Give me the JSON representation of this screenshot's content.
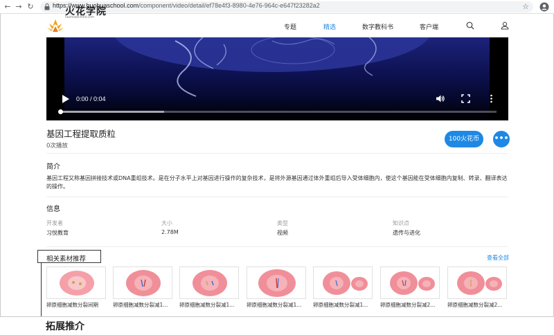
{
  "browser": {
    "url_host": "https://www.huohuaschool.com",
    "url_path": "/component/video/detail/ef78e4f3-8980-4e76-964c-e647f23282a2"
  },
  "header": {
    "logo_text": "火花学院",
    "logo_sub": "huohuaschool.com",
    "nav": [
      "专题",
      "精选",
      "数字教科书",
      "客户端"
    ],
    "active_nav": "精选",
    "accent_color": "#1e88e5"
  },
  "video": {
    "time": "0:00 / 0:04"
  },
  "resource": {
    "title": "基因工程提取质粒",
    "plays": "0次播放",
    "price_label": "100火花币",
    "more_label": "•••"
  },
  "intro": {
    "heading": "简介",
    "text": "基因工程又称基因拼接技术或DNA重组技术。是在分子水平上对基因进行操作的复杂技术，是将外源基因通过体外重组后导入受体细胞内，使这个基因能在受体细胞内复制、转录、翻译表达的操作。"
  },
  "info": {
    "heading": "信息",
    "fields": [
      {
        "label": "开发者",
        "value": "习悦教育"
      },
      {
        "label": "大小",
        "value": "2.78M"
      },
      {
        "label": "类型",
        "value": "视频"
      },
      {
        "label": "知识点",
        "value": "遗传与进化"
      }
    ]
  },
  "related": {
    "heading": "相关素材推荐",
    "view_all": "查看全部",
    "items": [
      {
        "caption": "卵原细胞减数分裂间期"
      },
      {
        "caption": "卵原细胞减数分裂减1..."
      },
      {
        "caption": "卵原细胞减数分裂减1..."
      },
      {
        "caption": "卵原细胞减数分裂减1..."
      },
      {
        "caption": "卵原细胞减数分裂减1..."
      },
      {
        "caption": "卵原细胞减数分裂减2..."
      },
      {
        "caption": "卵原细胞减数分裂减2..."
      }
    ]
  },
  "annotation": {
    "callout": "拓展推介"
  }
}
